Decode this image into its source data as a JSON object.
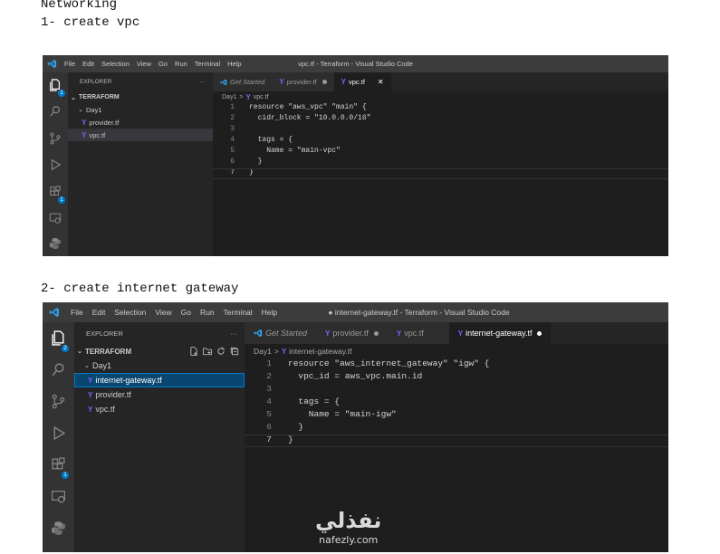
{
  "doc": {
    "heading": "Networking",
    "step1": "1- create vpc",
    "step2": "2- create internet gateway"
  },
  "colors": {
    "activitybar": "#333333",
    "sidebar": "#252526",
    "editor": "#1e1e1e",
    "titlebar": "#3c3c3c",
    "accent": "#007acc",
    "terraform": "#8b5cf6"
  },
  "menu": [
    "File",
    "Edit",
    "Selection",
    "View",
    "Go",
    "Run",
    "Terminal",
    "Help"
  ],
  "window1": {
    "title": "vpc.tf - Terraform - Visual Studio Code",
    "explorer_label": "EXPLORER",
    "more": "···",
    "root": "TERRAFORM",
    "folder": "Day1",
    "files": [
      "provider.tf",
      "vpc.tf"
    ],
    "tabs": [
      {
        "label": "Get Started",
        "icon": "vscode-icon"
      },
      {
        "label": "provider.tf",
        "icon": "terraform-icon",
        "dot": "●"
      },
      {
        "label": "vpc.tf",
        "icon": "terraform-icon",
        "close": "✕"
      }
    ],
    "breadcrumb": {
      "folder": "Day1",
      "sep": ">",
      "file": "vpc.tf"
    },
    "badges": {
      "explorer": "1",
      "extensions": "1"
    },
    "code": [
      {
        "n": "1",
        "t": "resource \"aws_vpc\" \"main\" {"
      },
      {
        "n": "2",
        "t": "  cidr_block = \"10.0.0.0/16\""
      },
      {
        "n": "3",
        "t": ""
      },
      {
        "n": "4",
        "t": "  tags = {"
      },
      {
        "n": "5",
        "t": "    Name = \"main-vpc\""
      },
      {
        "n": "6",
        "t": "  }"
      },
      {
        "n": "7",
        "t": "}"
      }
    ]
  },
  "window2": {
    "title": "● internet-gateway.tf - Terraform - Visual Studio Code",
    "explorer_label": "EXPLORER",
    "more": "···",
    "root": "TERRAFORM",
    "folder": "Day1",
    "files": [
      "internet-gateway.tf",
      "provider.tf",
      "vpc.tf"
    ],
    "tabs": [
      {
        "label": "Get Started",
        "icon": "vscode-icon"
      },
      {
        "label": "provider.tf",
        "icon": "terraform-icon",
        "dot": "●"
      },
      {
        "label": "vpc.tf",
        "icon": "terraform-icon"
      },
      {
        "label": "internet-gateway.tf",
        "icon": "terraform-icon",
        "dot": "●"
      }
    ],
    "breadcrumb": {
      "folder": "Day1",
      "sep": ">",
      "file": "internet-gateway.tf"
    },
    "badges": {
      "explorer": "2",
      "extensions": "1"
    },
    "code": [
      {
        "n": "1",
        "t": "resource \"aws_internet_gateway\" \"igw\" {"
      },
      {
        "n": "2",
        "t": "  vpc_id = aws_vpc.main.id"
      },
      {
        "n": "3",
        "t": ""
      },
      {
        "n": "4",
        "t": "  tags = {"
      },
      {
        "n": "5",
        "t": "    Name = \"main-igw\""
      },
      {
        "n": "6",
        "t": "  }"
      },
      {
        "n": "7",
        "t": "}"
      }
    ]
  },
  "watermark": {
    "arabic": "نفذلي",
    "url": "nafezly.com"
  }
}
